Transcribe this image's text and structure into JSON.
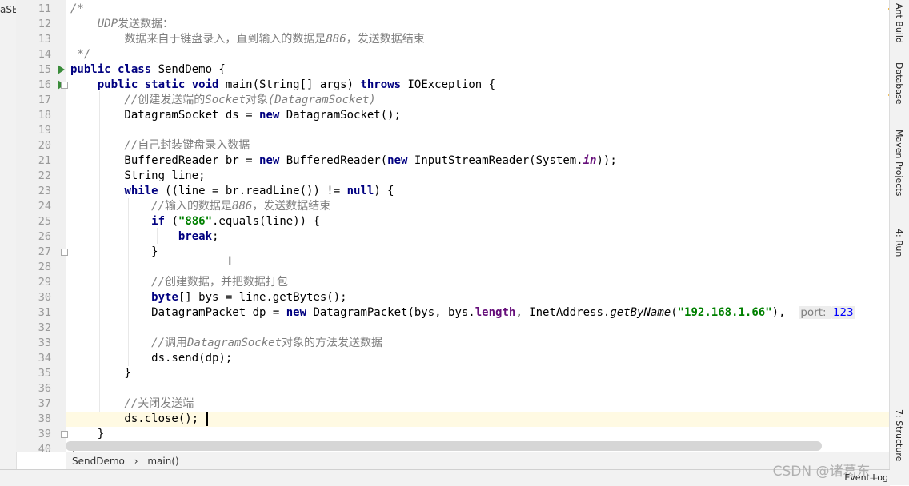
{
  "project_panel": {
    "label": "aSE"
  },
  "editor": {
    "lines": [
      {
        "num": "11",
        "segs": [
          {
            "t": "/*",
            "c": "cm"
          }
        ]
      },
      {
        "num": "12",
        "segs": [
          {
            "t": "    UDP",
            "c": "cm"
          },
          {
            "t": "发送数据：",
            "c": "cmz"
          }
        ]
      },
      {
        "num": "13",
        "segs": [
          {
            "t": "        ",
            "c": ""
          },
          {
            "t": "数据来自于键盘录入，直到输入的数据是",
            "c": "cmz"
          },
          {
            "t": "886",
            "c": "cm"
          },
          {
            "t": "，发送数据结束",
            "c": "cmz"
          }
        ]
      },
      {
        "num": "14",
        "segs": [
          {
            "t": " */",
            "c": "cm"
          }
        ]
      },
      {
        "num": "15",
        "segs": [
          {
            "t": "public class ",
            "c": "kw"
          },
          {
            "t": "SendDemo {",
            "c": ""
          }
        ]
      },
      {
        "num": "16",
        "segs": [
          {
            "t": "    ",
            "c": ""
          },
          {
            "t": "public static void ",
            "c": "kw"
          },
          {
            "t": "main(String[] args) ",
            "c": ""
          },
          {
            "t": "throws ",
            "c": "kw"
          },
          {
            "t": "IOException {",
            "c": ""
          }
        ]
      },
      {
        "num": "17",
        "segs": [
          {
            "t": "        //",
            "c": "cm"
          },
          {
            "t": "创建发送端的",
            "c": "cmz"
          },
          {
            "t": "Socket",
            "c": "cm"
          },
          {
            "t": "对象",
            "c": "cmz"
          },
          {
            "t": "(DatagramSocket)",
            "c": "cm"
          }
        ]
      },
      {
        "num": "18",
        "segs": [
          {
            "t": "        DatagramSocket ds = ",
            "c": ""
          },
          {
            "t": "new ",
            "c": "kw"
          },
          {
            "t": "DatagramSocket();",
            "c": ""
          }
        ]
      },
      {
        "num": "19",
        "segs": []
      },
      {
        "num": "20",
        "segs": [
          {
            "t": "        //",
            "c": "cm"
          },
          {
            "t": "自己封装键盘录入数据",
            "c": "cmz"
          }
        ]
      },
      {
        "num": "21",
        "segs": [
          {
            "t": "        BufferedReader br = ",
            "c": ""
          },
          {
            "t": "new ",
            "c": "kw"
          },
          {
            "t": "BufferedReader(",
            "c": ""
          },
          {
            "t": "new ",
            "c": "kw"
          },
          {
            "t": "InputStreamReader(System.",
            "c": ""
          },
          {
            "t": "in",
            "c": "fld stat"
          },
          {
            "t": "));",
            "c": ""
          }
        ]
      },
      {
        "num": "22",
        "segs": [
          {
            "t": "        String line;",
            "c": ""
          }
        ]
      },
      {
        "num": "23",
        "segs": [
          {
            "t": "        ",
            "c": ""
          },
          {
            "t": "while ",
            "c": "kw"
          },
          {
            "t": "((line = br.readLine()) != ",
            "c": ""
          },
          {
            "t": "null",
            "c": "kw"
          },
          {
            "t": ") {",
            "c": ""
          }
        ]
      },
      {
        "num": "24",
        "segs": [
          {
            "t": "            //",
            "c": "cm"
          },
          {
            "t": "输入的数据是",
            "c": "cmz"
          },
          {
            "t": "886",
            "c": "cm"
          },
          {
            "t": "，发送数据结束",
            "c": "cmz"
          }
        ]
      },
      {
        "num": "25",
        "segs": [
          {
            "t": "            ",
            "c": ""
          },
          {
            "t": "if ",
            "c": "kw"
          },
          {
            "t": "(",
            "c": ""
          },
          {
            "t": "\"886\"",
            "c": "str"
          },
          {
            "t": ".equals(line)) {",
            "c": ""
          }
        ]
      },
      {
        "num": "26",
        "segs": [
          {
            "t": "                ",
            "c": ""
          },
          {
            "t": "break",
            "c": "kw"
          },
          {
            "t": ";",
            "c": ""
          }
        ]
      },
      {
        "num": "27",
        "segs": [
          {
            "t": "            }",
            "c": ""
          }
        ]
      },
      {
        "num": "28",
        "segs": []
      },
      {
        "num": "29",
        "segs": [
          {
            "t": "            //",
            "c": "cm"
          },
          {
            "t": "创建数据，并把数据打包",
            "c": "cmz"
          }
        ]
      },
      {
        "num": "30",
        "segs": [
          {
            "t": "            ",
            "c": ""
          },
          {
            "t": "byte",
            "c": "kw"
          },
          {
            "t": "[] bys = line.getBytes();",
            "c": ""
          }
        ]
      },
      {
        "num": "31",
        "segs": [
          {
            "t": "            DatagramPacket dp = ",
            "c": ""
          },
          {
            "t": "new ",
            "c": "kw"
          },
          {
            "t": "DatagramPacket(bys, bys.",
            "c": ""
          },
          {
            "t": "length",
            "c": "fld"
          },
          {
            "t": ", InetAddress.",
            "c": ""
          },
          {
            "t": "getByName",
            "c": "stat"
          },
          {
            "t": "(",
            "c": ""
          },
          {
            "t": "\"192.168.1.66\"",
            "c": "str"
          },
          {
            "t": "),  ",
            "c": ""
          },
          {
            "t": "port: ",
            "c": "hint"
          },
          {
            "t": "123",
            "c": "hint hint-num"
          }
        ]
      },
      {
        "num": "32",
        "segs": []
      },
      {
        "num": "33",
        "segs": [
          {
            "t": "            //",
            "c": "cm"
          },
          {
            "t": "调用",
            "c": "cmz"
          },
          {
            "t": "DatagramSocket",
            "c": "cm"
          },
          {
            "t": "对象的方法发送数据",
            "c": "cmz"
          }
        ]
      },
      {
        "num": "34",
        "segs": [
          {
            "t": "            ds.send(dp);",
            "c": ""
          }
        ]
      },
      {
        "num": "35",
        "segs": [
          {
            "t": "        }",
            "c": ""
          }
        ]
      },
      {
        "num": "36",
        "segs": []
      },
      {
        "num": "37",
        "segs": [
          {
            "t": "        //",
            "c": "cm"
          },
          {
            "t": "关闭发送端",
            "c": "cmz"
          }
        ]
      },
      {
        "num": "38",
        "segs": [
          {
            "t": "        ds.close();",
            "c": ""
          }
        ]
      },
      {
        "num": "39",
        "segs": [
          {
            "t": "    }",
            "c": ""
          }
        ]
      },
      {
        "num": "40",
        "segs": [
          {
            "t": "}",
            "c": ""
          }
        ]
      }
    ],
    "current_line": "38"
  },
  "breadcrumb": {
    "class": "SendDemo",
    "method": "main()"
  },
  "tool_windows": {
    "ant": "Ant Build",
    "database": "Database",
    "maven": "Maven Projects",
    "run": "4: Run",
    "structure": "7: Structure"
  },
  "status": {
    "event_log": "Event Log"
  },
  "watermark": "CSDN @诸葛东_"
}
